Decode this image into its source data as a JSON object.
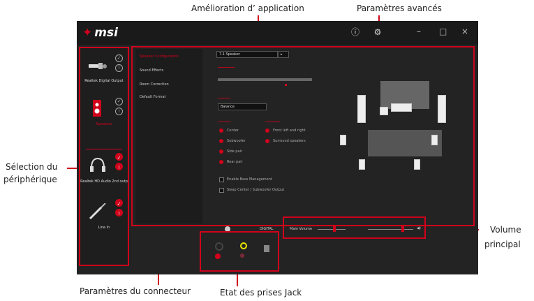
{
  "annotations": {
    "app_enhancement": "Amélioration d’ application",
    "advanced_params": "Paramètres avancés",
    "device_selection_line1": "Sélection du",
    "device_selection_line2": "périphérique",
    "main_volume_line1": "Volume",
    "main_volume_line2": "principal",
    "connector_params": "Paramètres du connecteur",
    "jack_status": "Etat des prises Jack"
  },
  "app": {
    "logo": "msi",
    "info_icon": "info-icon",
    "settings_icon": "gear-icon"
  },
  "devices": [
    {
      "label": "Realtek Digital Output",
      "status": "check"
    },
    {
      "label": "Speakers",
      "status": "check"
    },
    {
      "label": "Realtek HD Audio 2nd outp",
      "status": "red"
    },
    {
      "label": "Line In",
      "status": "red"
    }
  ],
  "menu": {
    "items": [
      "Speaker Configuration",
      "Sound Effects",
      "Room Correction",
      "Default Format"
    ]
  },
  "speaker": {
    "config_select": "7.1 Speaker",
    "balance_select": "Balance",
    "eq_label": "Enable Bass Management",
    "swap_label": "Swap Center / Subwoofer Output",
    "radios_left": [
      "Center",
      "Subwoofer",
      "Side pair",
      "Rear pair"
    ],
    "radios_right": [
      "Front left and right",
      "Surround speakers"
    ]
  },
  "volume": {
    "label": "Main Volume",
    "digital": "DIGITAL"
  },
  "colors": {
    "accent": "#d0021b",
    "background": "#232323"
  }
}
